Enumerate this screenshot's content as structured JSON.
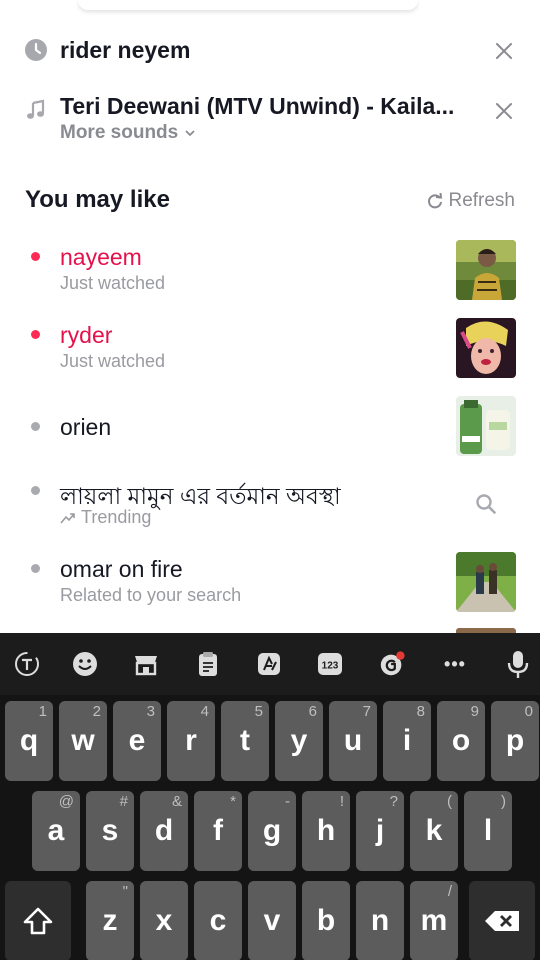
{
  "history": [
    {
      "text": "rider neyem",
      "icon": "clock-icon"
    },
    {
      "text": "Teri Deewani (MTV Unwind) - Kaila...",
      "icon": "music-note-icon",
      "sub": "More sounds"
    }
  ],
  "section": {
    "title": "You may like",
    "refresh": "Refresh"
  },
  "suggestions": [
    {
      "label": "nayeem",
      "sub": "Just watched",
      "highlight": true
    },
    {
      "label": "ryder",
      "sub": "Just watched",
      "highlight": true
    },
    {
      "label": "orien",
      "sub": ""
    },
    {
      "label": "লায়লা মামুন এর বর্তমান অবস্থা",
      "sub": "Trending"
    },
    {
      "label": "omar on fire",
      "sub": "Related to your search"
    }
  ],
  "keyboard": {
    "toolbar": [
      "text-mode-icon",
      "emoji-icon",
      "store-icon",
      "clipboard-icon",
      "translate-icon",
      "numbers-icon",
      "grammar-icon",
      "more-icon",
      "microphone-icon"
    ],
    "toolbar_numbers_label": "123",
    "toolbar_more_label": "•••",
    "row1": [
      {
        "k": "q",
        "h": "1"
      },
      {
        "k": "w",
        "h": "2"
      },
      {
        "k": "e",
        "h": "3"
      },
      {
        "k": "r",
        "h": "4"
      },
      {
        "k": "t",
        "h": "5"
      },
      {
        "k": "y",
        "h": "6"
      },
      {
        "k": "u",
        "h": "7"
      },
      {
        "k": "i",
        "h": "8"
      },
      {
        "k": "o",
        "h": "9"
      },
      {
        "k": "p",
        "h": "0"
      }
    ],
    "row2": [
      {
        "k": "a",
        "h": "@"
      },
      {
        "k": "s",
        "h": "#"
      },
      {
        "k": "d",
        "h": "&"
      },
      {
        "k": "f",
        "h": "*"
      },
      {
        "k": "g",
        "h": "-"
      },
      {
        "k": "h",
        "h": "!"
      },
      {
        "k": "j",
        "h": "?"
      },
      {
        "k": "k",
        "h": "("
      },
      {
        "k": "l",
        "h": ")"
      }
    ],
    "row3": [
      {
        "k": "z",
        "h": "\""
      },
      {
        "k": "x",
        "h": ""
      },
      {
        "k": "c",
        "h": ""
      },
      {
        "k": "v",
        "h": ""
      },
      {
        "k": "b",
        "h": ""
      },
      {
        "k": "n",
        "h": ""
      },
      {
        "k": "m",
        "h": "/"
      }
    ]
  },
  "colors": {
    "accent": "#fe2c55",
    "muted": "#8a8b91",
    "keyboard_bg": "#141414",
    "key_bg": "#5c5c5c"
  }
}
